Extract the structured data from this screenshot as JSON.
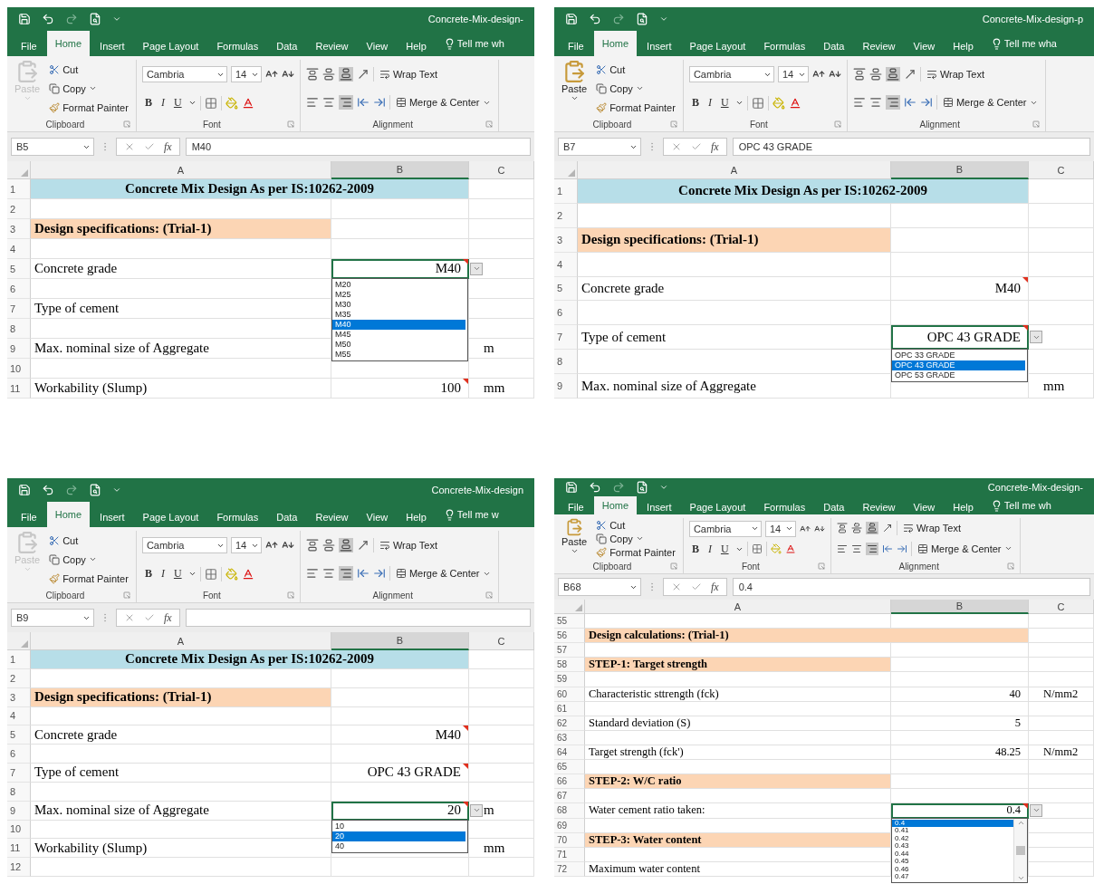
{
  "panels": [
    {
      "title": "Concrete-Mix-design-",
      "tabs": [
        {
          "label": "File",
          "selected": false
        },
        {
          "label": "Home",
          "selected": true
        },
        {
          "label": "Insert",
          "selected": false
        },
        {
          "label": "Page Layout",
          "selected": false
        },
        {
          "label": "Formulas",
          "selected": false
        },
        {
          "label": "Data",
          "selected": false
        },
        {
          "label": "Review",
          "selected": false
        },
        {
          "label": "View",
          "selected": false
        },
        {
          "label": "Help",
          "selected": false
        }
      ],
      "tell_me": "Tell me wh",
      "ribbon": {
        "paste": "Paste",
        "paste_enabled": false,
        "cut": "Cut",
        "copy": "Copy",
        "format_painter": "Format Painter",
        "clipboard": "Clipboard",
        "font_name": "Cambria",
        "font_size": "14",
        "bold": "B",
        "italic": "I",
        "underline": "U",
        "font": "Font",
        "wrap_text": "Wrap Text",
        "merge_center": "Merge & Center",
        "alignment": "Alignment"
      },
      "name_box": "B5",
      "fx": "fx",
      "formula": "M40",
      "columns": [
        {
          "label": "A",
          "selected": false
        },
        {
          "label": "B",
          "selected": true
        },
        {
          "label": "C",
          "selected": false
        }
      ],
      "rows": [
        {
          "number": "1",
          "kind": "title",
          "a": "Concrete Mix Design As per IS:10262-2009"
        },
        {
          "number": "2",
          "kind": "blank"
        },
        {
          "number": "3",
          "kind": "heading",
          "merged": false,
          "a": "Design specifications: (Trial-1)"
        },
        {
          "number": "4",
          "kind": "blank"
        },
        {
          "number": "5",
          "kind": "value",
          "a": "Concrete grade",
          "b": "M40",
          "flag": true,
          "active": true,
          "dropdown": {
            "scrollable": false,
            "options": [
              {
                "label": "M20",
                "selected": false
              },
              {
                "label": "M25",
                "selected": false
              },
              {
                "label": "M30",
                "selected": false
              },
              {
                "label": "M35",
                "selected": false
              },
              {
                "label": "M40",
                "selected": true
              },
              {
                "label": "M45",
                "selected": false
              },
              {
                "label": "M50",
                "selected": false
              },
              {
                "label": "M55",
                "selected": false
              }
            ]
          }
        },
        {
          "number": "6",
          "kind": "blank"
        },
        {
          "number": "7",
          "kind": "value",
          "a": "Type of cement",
          "flag": false,
          "active": false
        },
        {
          "number": "8",
          "kind": "blank"
        },
        {
          "number": "9",
          "kind": "value",
          "a": "Max. nominal size of Aggregate",
          "c": "m",
          "flag": false,
          "active": false
        },
        {
          "number": "10",
          "kind": "blank"
        },
        {
          "number": "11",
          "kind": "value",
          "a": "Workability (Slump)",
          "b": "100",
          "c": "mm",
          "flag": true,
          "active": false
        }
      ]
    },
    {
      "title": "Concrete-Mix-design-p",
      "tabs": [
        {
          "label": "File",
          "selected": false
        },
        {
          "label": "Home",
          "selected": true
        },
        {
          "label": "Insert",
          "selected": false
        },
        {
          "label": "Page Layout",
          "selected": false
        },
        {
          "label": "Formulas",
          "selected": false
        },
        {
          "label": "Data",
          "selected": false
        },
        {
          "label": "Review",
          "selected": false
        },
        {
          "label": "View",
          "selected": false
        },
        {
          "label": "Help",
          "selected": false
        }
      ],
      "tell_me": "Tell me wha",
      "ribbon": {
        "paste": "Paste",
        "paste_enabled": true,
        "cut": "Cut",
        "copy": "Copy",
        "format_painter": "Format Painter",
        "clipboard": "Clipboard",
        "font_name": "Cambria",
        "font_size": "14",
        "bold": "B",
        "italic": "I",
        "underline": "U",
        "font": "Font",
        "wrap_text": "Wrap Text",
        "merge_center": "Merge & Center",
        "alignment": "Alignment"
      },
      "name_box": "B7",
      "fx": "fx",
      "formula": "OPC 43 GRADE",
      "columns": [
        {
          "label": "A",
          "selected": false
        },
        {
          "label": "B",
          "selected": true
        },
        {
          "label": "C",
          "selected": false
        }
      ],
      "rows": [
        {
          "number": "1",
          "kind": "title",
          "a": "Concrete Mix Design As per IS:10262-2009"
        },
        {
          "number": "2",
          "kind": "blank"
        },
        {
          "number": "3",
          "kind": "heading",
          "merged": false,
          "a": "Design specifications: (Trial-1)"
        },
        {
          "number": "4",
          "kind": "blank"
        },
        {
          "number": "5",
          "kind": "value",
          "a": "Concrete grade",
          "b": "M40",
          "flag": true,
          "active": false
        },
        {
          "number": "6",
          "kind": "blank"
        },
        {
          "number": "7",
          "kind": "value",
          "a": "Type of cement",
          "b": "OPC 43 GRADE",
          "flag": true,
          "active": true,
          "dropdown": {
            "scrollable": false,
            "options": [
              {
                "label": "OPC 33 GRADE",
                "selected": false
              },
              {
                "label": "OPC 43 GRADE",
                "selected": true
              },
              {
                "label": "OPC 53 GRADE",
                "selected": false
              }
            ]
          }
        },
        {
          "number": "8",
          "kind": "blank"
        },
        {
          "number": "9",
          "kind": "value",
          "a": "Max. nominal size of Aggregate",
          "c": "mm",
          "flag": false,
          "active": false
        }
      ]
    },
    {
      "title": "Concrete-Mix-design",
      "tabs": [
        {
          "label": "File",
          "selected": false
        },
        {
          "label": "Home",
          "selected": true
        },
        {
          "label": "Insert",
          "selected": false
        },
        {
          "label": "Page Layout",
          "selected": false
        },
        {
          "label": "Formulas",
          "selected": false
        },
        {
          "label": "Data",
          "selected": false
        },
        {
          "label": "Review",
          "selected": false
        },
        {
          "label": "View",
          "selected": false
        },
        {
          "label": "Help",
          "selected": false
        }
      ],
      "tell_me": "Tell me w",
      "ribbon": {
        "paste": "Paste",
        "paste_enabled": false,
        "cut": "Cut",
        "copy": "Copy",
        "format_painter": "Format Painter",
        "clipboard": "Clipboard",
        "font_name": "Cambria",
        "font_size": "14",
        "bold": "B",
        "italic": "I",
        "underline": "U",
        "font": "Font",
        "wrap_text": "Wrap Text",
        "merge_center": "Merge & Center",
        "alignment": "Alignment"
      },
      "name_box": "B9",
      "fx": "fx",
      "columns": [
        {
          "label": "A",
          "selected": false
        },
        {
          "label": "B",
          "selected": true
        },
        {
          "label": "C",
          "selected": false
        }
      ],
      "rows": [
        {
          "number": "1",
          "kind": "title",
          "a": "Concrete Mix Design As per IS:10262-2009"
        },
        {
          "number": "2",
          "kind": "blank"
        },
        {
          "number": "3",
          "kind": "heading",
          "merged": false,
          "a": "Design specifications: (Trial-1)"
        },
        {
          "number": "4",
          "kind": "blank"
        },
        {
          "number": "5",
          "kind": "value",
          "a": "Concrete grade",
          "b": "M40",
          "flag": true,
          "active": false
        },
        {
          "number": "6",
          "kind": "blank"
        },
        {
          "number": "7",
          "kind": "value",
          "a": "Type of cement",
          "b": "OPC 43 GRADE",
          "flag": true,
          "active": false
        },
        {
          "number": "8",
          "kind": "blank"
        },
        {
          "number": "9",
          "kind": "value",
          "a": "Max. nominal size of Aggregate",
          "b": "20",
          "c": "m",
          "flag": true,
          "active": true,
          "dropdown": {
            "scrollable": false,
            "options": [
              {
                "label": "10",
                "selected": false
              },
              {
                "label": "20",
                "selected": true
              },
              {
                "label": "40",
                "selected": false
              }
            ]
          }
        },
        {
          "number": "10",
          "kind": "blank"
        },
        {
          "number": "11",
          "kind": "value",
          "a": "Workability (Slump)",
          "c": "mm",
          "flag": false,
          "active": false
        },
        {
          "number": "12",
          "kind": "blank"
        }
      ]
    },
    {
      "title": "Concrete-Mix-design-",
      "tabs": [
        {
          "label": "File",
          "selected": false
        },
        {
          "label": "Home",
          "selected": true
        },
        {
          "label": "Insert",
          "selected": false
        },
        {
          "label": "Page Layout",
          "selected": false
        },
        {
          "label": "Formulas",
          "selected": false
        },
        {
          "label": "Data",
          "selected": false
        },
        {
          "label": "Review",
          "selected": false
        },
        {
          "label": "View",
          "selected": false
        },
        {
          "label": "Help",
          "selected": false
        }
      ],
      "tell_me": "Tell me wh",
      "ribbon": {
        "paste": "Paste",
        "paste_enabled": true,
        "cut": "Cut",
        "copy": "Copy",
        "format_painter": "Format Painter",
        "clipboard": "Clipboard",
        "font_name": "Cambria",
        "font_size": "14",
        "bold": "B",
        "italic": "I",
        "underline": "U",
        "font": "Font",
        "wrap_text": "Wrap Text",
        "merge_center": "Merge & Center",
        "alignment": "Alignment"
      },
      "name_box": "B68",
      "fx": "fx",
      "formula": "0.4",
      "columns": [
        {
          "label": "A",
          "selected": false
        },
        {
          "label": "B",
          "selected": true
        },
        {
          "label": "C",
          "selected": false
        }
      ],
      "rows": [
        {
          "number": "55",
          "kind": "blank"
        },
        {
          "number": "56",
          "kind": "heading",
          "merged": true,
          "a": "Design calculations: (Trial-1)"
        },
        {
          "number": "57",
          "kind": "blank"
        },
        {
          "number": "58",
          "kind": "heading",
          "merged": false,
          "a": "STEP-1: Target strength"
        },
        {
          "number": "59",
          "kind": "blank"
        },
        {
          "number": "60",
          "kind": "value",
          "a": "Characteristic sttrength (fck)",
          "b": "40",
          "c": "N/mm2",
          "flag": false,
          "active": false
        },
        {
          "number": "61",
          "kind": "blank"
        },
        {
          "number": "62",
          "kind": "value",
          "a": "Standard deviation (S)",
          "b": "5",
          "flag": false,
          "active": false
        },
        {
          "number": "63",
          "kind": "blank"
        },
        {
          "number": "64",
          "kind": "value",
          "a": "Target strength (fck')",
          "b": "48.25",
          "c": "N/mm2",
          "flag": false,
          "active": false
        },
        {
          "number": "65",
          "kind": "blank"
        },
        {
          "number": "66",
          "kind": "heading",
          "merged": false,
          "a": "STEP-2: W/C ratio"
        },
        {
          "number": "67",
          "kind": "blank"
        },
        {
          "number": "68",
          "kind": "value",
          "a": "Water cement ratio taken:",
          "b": "0.4",
          "flag": true,
          "active": true,
          "dropdown": {
            "scrollable": true,
            "options": [
              {
                "label": "0.4",
                "selected": true
              },
              {
                "label": "0.41",
                "selected": false
              },
              {
                "label": "0.42",
                "selected": false
              },
              {
                "label": "0.43",
                "selected": false
              },
              {
                "label": "0.44",
                "selected": false
              },
              {
                "label": "0.45",
                "selected": false
              },
              {
                "label": "0.46",
                "selected": false
              },
              {
                "label": "0.47",
                "selected": false
              }
            ]
          }
        },
        {
          "number": "69",
          "kind": "blank"
        },
        {
          "number": "70",
          "kind": "heading",
          "merged": false,
          "a": "STEP-3: Water content"
        },
        {
          "number": "71",
          "kind": "blank"
        },
        {
          "number": "72",
          "kind": "value",
          "a": "Maximum water content",
          "flag": false,
          "active": false
        }
      ]
    }
  ]
}
